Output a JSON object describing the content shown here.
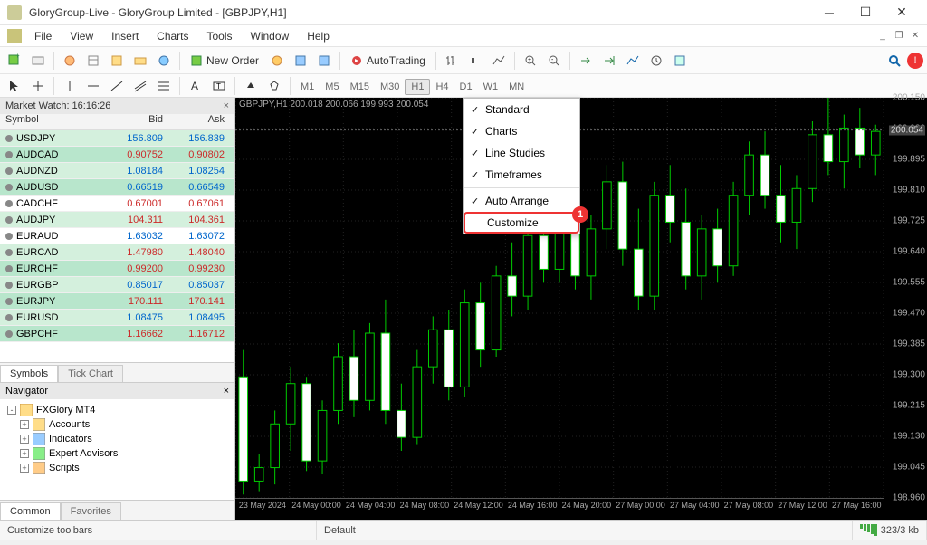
{
  "window": {
    "title": "GloryGroup-Live - GloryGroup Limited - [GBPJPY,H1]"
  },
  "menu": [
    "File",
    "View",
    "Insert",
    "Charts",
    "Tools",
    "Window",
    "Help"
  ],
  "toolbar": {
    "new_order": "New Order",
    "auto_trading": "AutoTrading"
  },
  "timeframes": [
    "M1",
    "M5",
    "M15",
    "M30",
    "H1",
    "H4",
    "D1",
    "W1",
    "MN"
  ],
  "active_timeframe": "H1",
  "market_watch": {
    "title": "Market Watch: 16:16:26",
    "columns": [
      "Symbol",
      "Bid",
      "Ask"
    ],
    "rows": [
      {
        "sym": "USDJPY",
        "bid": "156.809",
        "ask": "156.839",
        "cls": "blue",
        "row": "alt"
      },
      {
        "sym": "AUDCAD",
        "bid": "0.90752",
        "ask": "0.90802",
        "cls": "red",
        "row": "sel"
      },
      {
        "sym": "AUDNZD",
        "bid": "1.08184",
        "ask": "1.08254",
        "cls": "blue",
        "row": "alt"
      },
      {
        "sym": "AUDUSD",
        "bid": "0.66519",
        "ask": "0.66549",
        "cls": "blue",
        "row": "sel"
      },
      {
        "sym": "CADCHF",
        "bid": "0.67001",
        "ask": "0.67061",
        "cls": "red",
        "row": ""
      },
      {
        "sym": "AUDJPY",
        "bid": "104.311",
        "ask": "104.361",
        "cls": "red",
        "row": "alt"
      },
      {
        "sym": "EURAUD",
        "bid": "1.63032",
        "ask": "1.63072",
        "cls": "blue",
        "row": ""
      },
      {
        "sym": "EURCAD",
        "bid": "1.47980",
        "ask": "1.48040",
        "cls": "red",
        "row": "alt"
      },
      {
        "sym": "EURCHF",
        "bid": "0.99200",
        "ask": "0.99230",
        "cls": "red",
        "row": "sel"
      },
      {
        "sym": "EURGBP",
        "bid": "0.85017",
        "ask": "0.85037",
        "cls": "blue",
        "row": "alt"
      },
      {
        "sym": "EURJPY",
        "bid": "170.111",
        "ask": "170.141",
        "cls": "red",
        "row": "sel"
      },
      {
        "sym": "EURUSD",
        "bid": "1.08475",
        "ask": "1.08495",
        "cls": "blue",
        "row": "alt"
      },
      {
        "sym": "GBPCHF",
        "bid": "1.16662",
        "ask": "1.16712",
        "cls": "red",
        "row": "sel"
      }
    ],
    "tabs": [
      "Symbols",
      "Tick Chart"
    ]
  },
  "navigator": {
    "title": "Navigator",
    "root": "FXGlory MT4",
    "nodes": [
      "Accounts",
      "Indicators",
      "Expert Advisors",
      "Scripts"
    ],
    "tabs": [
      "Common",
      "Favorites"
    ]
  },
  "context_menu": {
    "items": [
      {
        "label": "Standard",
        "checked": true
      },
      {
        "label": "Charts",
        "checked": true
      },
      {
        "label": "Line Studies",
        "checked": true
      },
      {
        "label": "Timeframes",
        "checked": true
      }
    ],
    "items2": [
      {
        "label": "Auto Arrange",
        "checked": true
      },
      {
        "label": "Customize",
        "checked": false,
        "highlight": true
      }
    ],
    "callout": "1"
  },
  "chart": {
    "header": "GBPJPY,H1  200.018 200.066 199.993 200.054",
    "yticks": [
      "200.150",
      "199.980",
      "199.895",
      "199.810",
      "199.725",
      "199.640",
      "199.555",
      "199.470",
      "199.385",
      "199.300",
      "199.215",
      "199.130",
      "199.045",
      "198.960"
    ],
    "current_price": "200.054",
    "xticks": [
      "23 May 2024",
      "24 May 00:00",
      "24 May 04:00",
      "24 May 08:00",
      "24 May 12:00",
      "24 May 16:00",
      "24 May 20:00",
      "27 May 00:00",
      "27 May 04:00",
      "27 May 08:00",
      "27 May 12:00",
      "27 May 16:00"
    ]
  },
  "status": {
    "left": "Customize toolbars",
    "center": "Default",
    "right": "323/3 kb"
  },
  "chart_data": {
    "type": "candlestick",
    "symbol": "GBPJPY",
    "timeframe": "H1",
    "ylim": [
      198.96,
      200.15
    ],
    "candles": [
      {
        "o": 199.32,
        "h": 199.4,
        "l": 198.97,
        "c": 199.01
      },
      {
        "o": 199.01,
        "h": 199.09,
        "l": 198.98,
        "c": 199.05
      },
      {
        "o": 199.05,
        "h": 199.22,
        "l": 199.0,
        "c": 199.18
      },
      {
        "o": 199.18,
        "h": 199.35,
        "l": 199.1,
        "c": 199.3
      },
      {
        "o": 199.3,
        "h": 199.32,
        "l": 199.04,
        "c": 199.07
      },
      {
        "o": 199.07,
        "h": 199.25,
        "l": 199.03,
        "c": 199.22
      },
      {
        "o": 199.22,
        "h": 199.42,
        "l": 199.18,
        "c": 199.38
      },
      {
        "o": 199.38,
        "h": 199.46,
        "l": 199.2,
        "c": 199.25
      },
      {
        "o": 199.25,
        "h": 199.48,
        "l": 199.22,
        "c": 199.45
      },
      {
        "o": 199.45,
        "h": 199.55,
        "l": 199.18,
        "c": 199.22
      },
      {
        "o": 199.22,
        "h": 199.3,
        "l": 199.1,
        "c": 199.14
      },
      {
        "o": 199.14,
        "h": 199.4,
        "l": 199.12,
        "c": 199.35
      },
      {
        "o": 199.35,
        "h": 199.5,
        "l": 199.3,
        "c": 199.46
      },
      {
        "o": 199.46,
        "h": 199.52,
        "l": 199.25,
        "c": 199.29
      },
      {
        "o": 199.29,
        "h": 199.58,
        "l": 199.26,
        "c": 199.54
      },
      {
        "o": 199.54,
        "h": 199.6,
        "l": 199.35,
        "c": 199.4
      },
      {
        "o": 199.4,
        "h": 199.65,
        "l": 199.38,
        "c": 199.62
      },
      {
        "o": 199.62,
        "h": 199.72,
        "l": 199.5,
        "c": 199.56
      },
      {
        "o": 199.56,
        "h": 199.78,
        "l": 199.52,
        "c": 199.74
      },
      {
        "o": 199.74,
        "h": 199.82,
        "l": 199.6,
        "c": 199.64
      },
      {
        "o": 199.64,
        "h": 199.88,
        "l": 199.6,
        "c": 199.85
      },
      {
        "o": 199.85,
        "h": 199.92,
        "l": 199.58,
        "c": 199.62
      },
      {
        "o": 199.62,
        "h": 199.8,
        "l": 199.55,
        "c": 199.76
      },
      {
        "o": 199.76,
        "h": 199.95,
        "l": 199.7,
        "c": 199.9
      },
      {
        "o": 199.9,
        "h": 199.96,
        "l": 199.65,
        "c": 199.7
      },
      {
        "o": 199.7,
        "h": 199.82,
        "l": 199.52,
        "c": 199.56
      },
      {
        "o": 199.56,
        "h": 199.9,
        "l": 199.52,
        "c": 199.86
      },
      {
        "o": 199.86,
        "h": 199.95,
        "l": 199.72,
        "c": 199.78
      },
      {
        "o": 199.78,
        "h": 199.88,
        "l": 199.58,
        "c": 199.62
      },
      {
        "o": 199.62,
        "h": 199.8,
        "l": 199.55,
        "c": 199.76
      },
      {
        "o": 199.76,
        "h": 199.82,
        "l": 199.6,
        "c": 199.65
      },
      {
        "o": 199.65,
        "h": 199.9,
        "l": 199.62,
        "c": 199.86
      },
      {
        "o": 199.86,
        "h": 200.02,
        "l": 199.8,
        "c": 199.98
      },
      {
        "o": 199.98,
        "h": 200.05,
        "l": 199.82,
        "c": 199.86
      },
      {
        "o": 199.86,
        "h": 199.95,
        "l": 199.72,
        "c": 199.78
      },
      {
        "o": 199.78,
        "h": 199.92,
        "l": 199.7,
        "c": 199.88
      },
      {
        "o": 199.88,
        "h": 200.08,
        "l": 199.84,
        "c": 200.04
      },
      {
        "o": 200.04,
        "h": 200.15,
        "l": 199.92,
        "c": 199.96
      },
      {
        "o": 199.96,
        "h": 200.1,
        "l": 199.88,
        "c": 200.06
      },
      {
        "o": 200.06,
        "h": 200.12,
        "l": 199.94,
        "c": 199.98
      },
      {
        "o": 199.98,
        "h": 200.07,
        "l": 199.92,
        "c": 200.05
      }
    ]
  }
}
